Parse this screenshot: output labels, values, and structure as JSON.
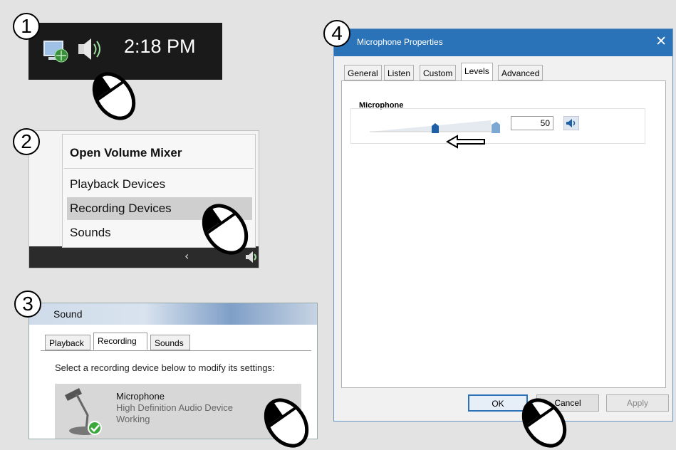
{
  "steps": [
    "1",
    "2",
    "3",
    "4"
  ],
  "panel1": {
    "clock": "2:18 PM"
  },
  "panel2": {
    "menu_items": [
      "Open Volume Mixer",
      "Playback Devices",
      "Recording Devices",
      "Sounds"
    ]
  },
  "panel3": {
    "title": "Sound",
    "tabs": [
      "Playback",
      "Recording",
      "Sounds"
    ],
    "instruction": "Select a recording device below to modify its settings:",
    "device": {
      "name": "Microphone",
      "description": "High Definition Audio Device",
      "status": "Working"
    }
  },
  "panel4": {
    "title": "Microphone Properties",
    "close": "✕",
    "tabs": [
      "General",
      "Listen",
      "Custom",
      "Levels",
      "Advanced"
    ],
    "section_label": "Microphone",
    "level_value": "50",
    "level_fraction": 0.5,
    "buttons": {
      "ok": "OK",
      "cancel": "Cancel",
      "apply": "Apply"
    }
  },
  "colors": {
    "accent": "#2a73b8",
    "selected_menu": "#cfcfcf",
    "slider": "#3f7fc0"
  }
}
